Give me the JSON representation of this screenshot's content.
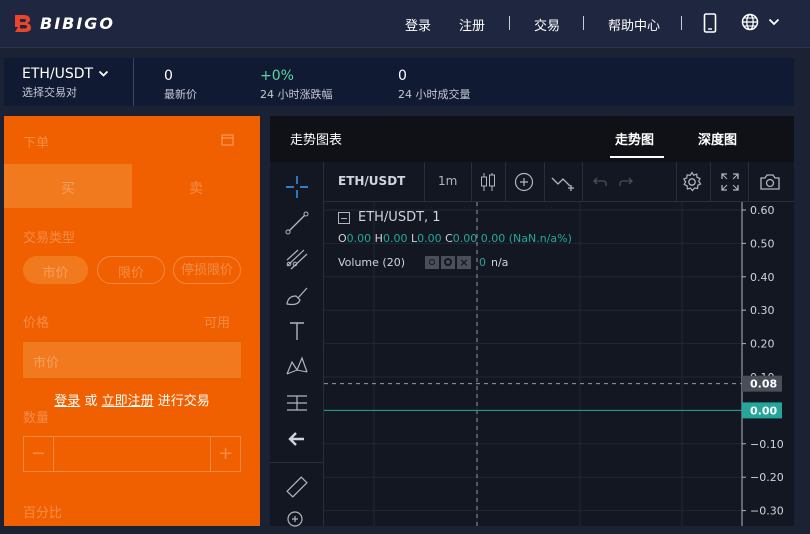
{
  "brand": {
    "name": "BIBIGO"
  },
  "nav": {
    "login": "登录",
    "register": "注册",
    "trade": "交易",
    "help": "帮助中心"
  },
  "ticker": {
    "pair": "ETH/USDT",
    "pair_sub": "选择交易对",
    "last_price": {
      "value": "0",
      "label": "最新价"
    },
    "change": {
      "value": "+0%",
      "label": "24 小时涨跌幅"
    },
    "volume": {
      "value": "0",
      "label": "24 小时成交量"
    }
  },
  "order": {
    "title": "下单",
    "buy": "买",
    "sell": "卖",
    "type_label": "交易类型",
    "types": [
      "市价",
      "限价",
      "停损限价"
    ],
    "price_label": "价格",
    "price_right": "可用",
    "price_placeholder": "市价",
    "login_prompt": {
      "login": "登录",
      "or": "或",
      "register": "立即注册",
      "suffix": "进行交易"
    },
    "qty_label": "数量",
    "minus": "−",
    "plus": "+",
    "percent_label": "百分比"
  },
  "chart_tabs": {
    "title": "走势图表",
    "trend": "走势图",
    "depth": "深度图"
  },
  "tv": {
    "symbol": "ETH/USDT",
    "interval": "1m",
    "legend_symbol": "ETH/USDT, 1",
    "ohlc": {
      "o_label": "O",
      "o": "0.00",
      "h_label": "H",
      "h": "0.00",
      "l_label": "L",
      "l": "0.00",
      "c_label": "C",
      "c": "0.00",
      "chg": "0.00 (NaN.n/a%)"
    },
    "volume_label": "Volume (20)",
    "volume_value": "0",
    "volume_na": "n/a",
    "axis_labels": [
      "0.60",
      "0.50",
      "0.40",
      "0.30",
      "0.20",
      "0.10",
      "0.00",
      "−0.10",
      "−0.20",
      "−0.30"
    ],
    "crosshair_label": "0.08",
    "price_label": "0.00",
    "colors": {
      "accent": "#26a69a",
      "bg": "#131722"
    }
  },
  "colors": {
    "orange": "#f06000",
    "topbar": "#1e2640",
    "ticker_bg": "#101a33",
    "green": "#5cd6a0"
  }
}
